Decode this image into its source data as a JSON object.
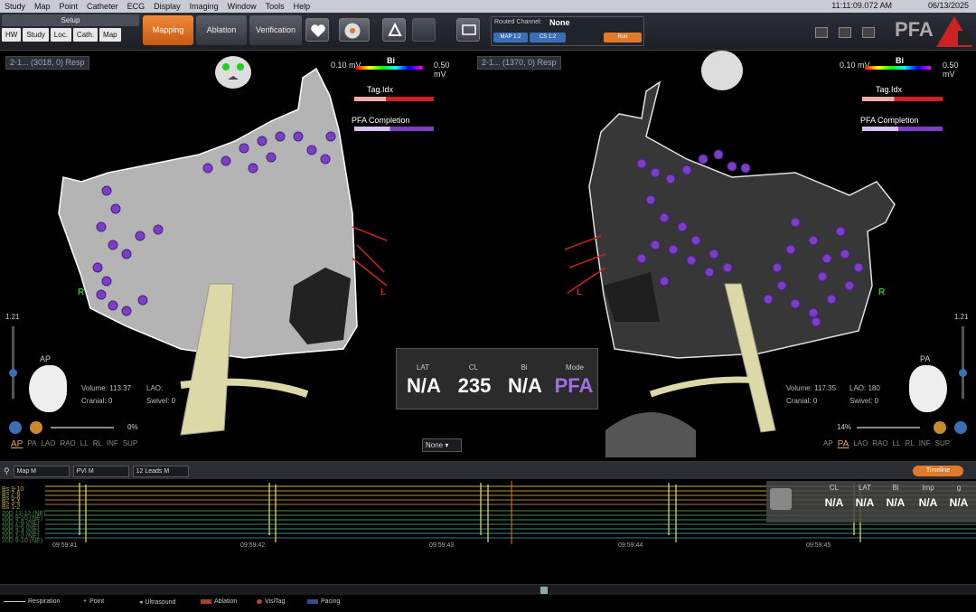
{
  "menu": {
    "items": [
      "Study",
      "Map",
      "Point",
      "Catheter",
      "ECG",
      "Display",
      "Imaging",
      "Window",
      "Tools",
      "Help"
    ],
    "time": "11:11:09.072 AM",
    "date": "06/13/2025"
  },
  "toolbar": {
    "setup_label": "Setup",
    "setup_buttons": [
      "HW",
      "Study",
      "Loc.",
      "Cath.",
      "Map"
    ],
    "workflow_tabs": [
      "Mapping",
      "Ablation",
      "Verification"
    ],
    "active_tab": "Mapping",
    "routed_channel_label": "Routed Channel:",
    "routed_channel_value": "None",
    "chips": [
      "MAP 1:2",
      "CS 1:2",
      "Run"
    ],
    "brand": "PFA"
  },
  "left_map": {
    "name": "2-1... (3018, 0) Resp",
    "scale_min": "0.10 mV",
    "scale_label": "Bi",
    "scale_max": "0.50 mV",
    "tag_label": "Tag.Idx",
    "pfa_label": "PFA Completion",
    "zoom": "1.21",
    "view": "AP",
    "volume_label": "Volume:",
    "volume_value": "113.37",
    "cranial_label": "Cranial:",
    "cranial_value": "0",
    "lao_label": "LAO:",
    "swivel_label": "Swivel:",
    "swivel_value": "0",
    "opacity": "0%",
    "orient_right": "R",
    "orient_left": "L",
    "views": [
      "AP",
      "PA",
      "LAO",
      "RAO",
      "LL",
      "RL",
      "INF",
      "SUP"
    ],
    "active_view": "AP",
    "dropdown": "None"
  },
  "right_map": {
    "name": "2-1... (1370, 0) Resp",
    "scale_min": "0.10 mV",
    "scale_label": "Bi",
    "scale_max": "0.50 mV",
    "tag_label": "Tag.Idx",
    "pfa_label": "PFA Completion",
    "zoom": "1.21",
    "view": "PA",
    "volume_label": "Volume:",
    "volume_value": "117.35",
    "cranial_label": "Cranial:",
    "cranial_value": "0",
    "lao_label": "LAO:",
    "lao_value": "180",
    "swivel_label": "Swivel:",
    "swivel_value": "0",
    "opacity": "14%",
    "orient_right": "R",
    "orient_left": "L",
    "views": [
      "AP",
      "PA",
      "LAO",
      "RAO",
      "LL",
      "RL",
      "INF",
      "SUP"
    ],
    "active_view": "PA"
  },
  "overlay": {
    "headers": [
      "LAT",
      "CL",
      "Bi",
      "Mode"
    ],
    "values": [
      "N/A",
      "235",
      "N/A",
      "PFA"
    ]
  },
  "ecg": {
    "selects": [
      "Map M",
      "PVI M",
      "12 Leads M"
    ],
    "timeline_label": "Timeline",
    "trace_labels": [
      "Bs 9-10",
      "Bs 7-8",
      "Bs 5-6",
      "Bs 3-4",
      "Bs 1-2",
      "20D 11-12 (NE)",
      "20D 9-10 (NE)",
      "20D 7-8 (NE)",
      "20D 5-6 (NE)",
      "20D 3-4 (NE)",
      "20D 1-2 (NE)",
      "20D 9-10 (NE)"
    ],
    "times": [
      "09:59:41",
      "09:59:42",
      "09:59:43",
      "09:59:44",
      "09:59:45"
    ],
    "readout_headers": [
      "CL",
      "LAT",
      "Bi",
      "Imp",
      "g"
    ],
    "readout_values": [
      "N/A",
      "N/A",
      "N/A",
      "N/A",
      "N/A"
    ]
  },
  "status": {
    "items": [
      "Respiration",
      "Point",
      "Ultrasound",
      "Ablation",
      "VisiTag",
      "Pacing"
    ]
  },
  "colors": {
    "accent": "#e07a2a",
    "dot": "#7b3fc4",
    "mesh": "#b4b4b4"
  }
}
